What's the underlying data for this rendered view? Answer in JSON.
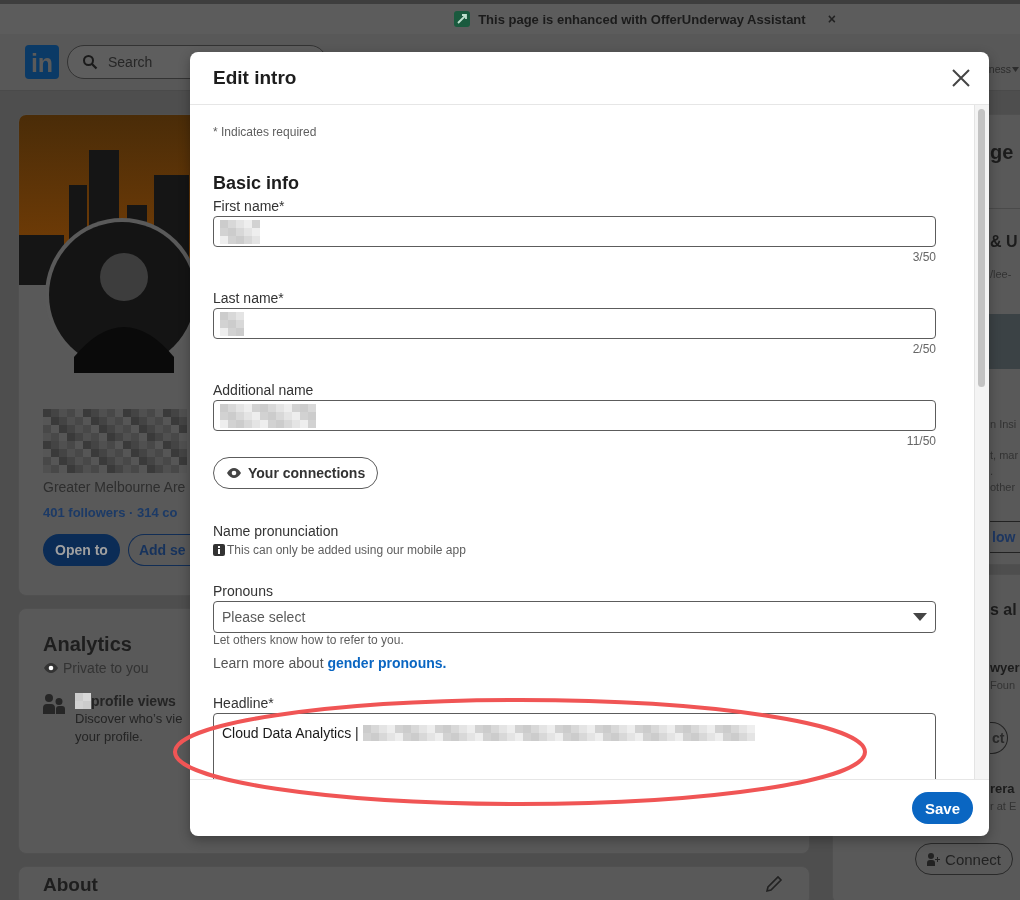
{
  "extension_banner": {
    "message": "This page is enhanced with OfferUnderway Assistant",
    "close": "×"
  },
  "nav": {
    "logo": "in",
    "search": {
      "placeholder": "Search"
    },
    "menu_label": "ness"
  },
  "profile": {
    "redacted_name": true,
    "location": "Greater Melbourne Are",
    "stats": "401 followers · 314 co",
    "buttons": [
      {
        "label": "Open to",
        "kind": "primary"
      },
      {
        "label": "Add se",
        "kind": "outline"
      }
    ]
  },
  "analytics": {
    "title": "Analytics",
    "visibility": "Private to you",
    "views_label": "profile views",
    "description_lines": [
      "Discover who’s vie",
      "your profile."
    ]
  },
  "about": {
    "title": "About"
  },
  "sidebar": [
    {
      "kind": "title",
      "text": "ge"
    },
    {
      "kind": "divider"
    },
    {
      "kind": "subtitle",
      "text": "& U"
    },
    {
      "kind": "text",
      "text": "/lee-"
    },
    {
      "kind": "band"
    },
    {
      "kind": "text",
      "text": "n Insi"
    },
    {
      "kind": "text",
      "text": "t, mar"
    },
    {
      "kind": "text",
      "text": "."
    },
    {
      "kind": "text",
      "text": "other"
    },
    {
      "kind": "button",
      "text": "low"
    },
    {
      "kind": "gap"
    },
    {
      "kind": "subtitle",
      "text": "s al"
    },
    {
      "kind": "name",
      "text": "wyer"
    },
    {
      "kind": "text",
      "text": "Foun"
    },
    {
      "kind": "button",
      "text": "ct"
    },
    {
      "kind": "name",
      "text": "rera"
    },
    {
      "kind": "text",
      "text": "r at E"
    },
    {
      "kind": "connect",
      "text": "Connect"
    }
  ],
  "modal": {
    "title": "Edit intro",
    "required_note": "* Indicates required",
    "section": "Basic info",
    "fields": [
      {
        "kind": "text",
        "label": "First name*",
        "redacted": true,
        "counter": "3/50"
      },
      {
        "kind": "text",
        "label": "Last name*",
        "redacted": true,
        "counter": "2/50"
      },
      {
        "kind": "text",
        "label": "Additional name",
        "redacted": true,
        "counter": "11/50"
      },
      {
        "kind": "visibility",
        "label": "Your connections"
      },
      {
        "kind": "note",
        "label": "Name pronunciation",
        "info": "This can only be added using our mobile app"
      },
      {
        "kind": "select",
        "label": "Pronouns",
        "placeholder": "Please select",
        "hint": "Let others know how to refer to you.",
        "learn_more": "Learn more about ",
        "link": "gender pronouns."
      },
      {
        "kind": "textarea",
        "label": "Headline*",
        "value": "Cloud Data Analytics |",
        "redacted": true
      }
    ],
    "save": "Save"
  }
}
